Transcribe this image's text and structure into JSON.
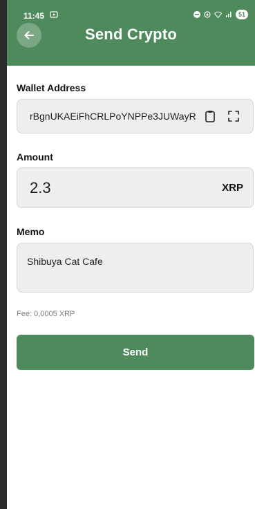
{
  "status_bar": {
    "time": "11:45",
    "battery": "51"
  },
  "header": {
    "title": "Send Crypto"
  },
  "form": {
    "wallet_label": "Wallet Address",
    "wallet_value": "rBgnUKAEiFhCRLPoYNPPe3JUWayR",
    "amount_label": "Amount",
    "amount_value": "2.3",
    "amount_unit": "XRP",
    "memo_label": "Memo",
    "memo_value": "Shibuya Cat Cafe",
    "fee_text": "Fee: 0,0005 XRP",
    "send_label": "Send"
  },
  "icons": {
    "back": "arrow-left-icon",
    "paste": "clipboard-icon",
    "scan": "qr-scan-icon"
  },
  "colors": {
    "accent": "#4f8a5d",
    "field_bg": "#eeeeef"
  }
}
